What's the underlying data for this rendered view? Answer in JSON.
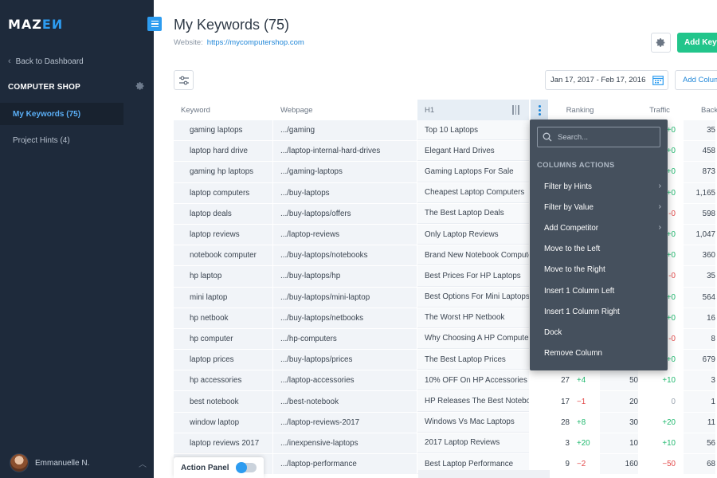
{
  "brand": {
    "logo_main": "MAZ",
    "logo_accent": "EИ"
  },
  "sidebar": {
    "back_label": "Back to Dashboard",
    "project_name": "COMPUTER SHOP",
    "items": [
      {
        "label": "My Keywords (75)"
      },
      {
        "label": "Project Hints (4)"
      }
    ],
    "user_name": "Emmanuelle N."
  },
  "header": {
    "title": "My Keywords (75)",
    "website_label": "Website:",
    "website_url": "https://mycomputershop.com",
    "add_button": "Add Keyw",
    "date_range": "Jan 17, 2017 - Feb 17, 2016",
    "add_column_button": "Add Colum"
  },
  "columns": {
    "keyword": "Keyword",
    "webpage": "Webpage",
    "h1": "H1",
    "ranking": "Ranking",
    "traffic": "Traffic",
    "backlinks": "Back"
  },
  "rows": [
    {
      "keyword": "gaming laptops",
      "webpage": ".../gaming",
      "h1": "Top 10 Laptops",
      "rank": "",
      "rank_delta": "",
      "traffic": "",
      "traffic_delta": "+0",
      "backlinks": "35"
    },
    {
      "keyword": "laptop hard drive",
      "webpage": ".../laptop-internal-hard-drives",
      "h1": "Elegant Hard Drives",
      "rank": "",
      "rank_delta": "",
      "traffic": "",
      "traffic_delta": "+0",
      "backlinks": "458"
    },
    {
      "keyword": "gaming hp laptops",
      "webpage": ".../gaming-laptops",
      "h1": "Gaming Laptops For Sale",
      "rank": "",
      "rank_delta": "",
      "traffic": "",
      "traffic_delta": "+0",
      "backlinks": "873"
    },
    {
      "keyword": "laptop computers",
      "webpage": ".../buy-laptops",
      "h1": "Cheapest Laptop Computers",
      "rank": "",
      "rank_delta": "",
      "traffic": "",
      "traffic_delta": "+0",
      "backlinks": "1,165"
    },
    {
      "keyword": "laptop deals",
      "webpage": ".../buy-laptops/offers",
      "h1": "The Best Laptop Deals",
      "rank": "",
      "rank_delta": "",
      "traffic": "",
      "traffic_delta": "-0",
      "backlinks": "598"
    },
    {
      "keyword": "laptop reviews",
      "webpage": ".../laptop-reviews",
      "h1": "Only Laptop Reviews",
      "rank": "",
      "rank_delta": "",
      "traffic": "",
      "traffic_delta": "+0",
      "backlinks": "1,047"
    },
    {
      "keyword": "notebook computer",
      "webpage": ".../buy-laptops/notebooks",
      "h1": "Brand New Notebook Computers",
      "rank": "",
      "rank_delta": "",
      "traffic": "",
      "traffic_delta": "+0",
      "backlinks": "360"
    },
    {
      "keyword": "hp laptop",
      "webpage": ".../buy-laptops/hp",
      "h1": "Best Prices For HP Laptops",
      "rank": "",
      "rank_delta": "",
      "traffic": "",
      "traffic_delta": "-0",
      "backlinks": "35"
    },
    {
      "keyword": "mini laptop",
      "webpage": ".../buy-laptops/mini-laptop",
      "h1": "Best Options For Mini Laptops",
      "rank": "",
      "rank_delta": "",
      "traffic": "",
      "traffic_delta": "+0",
      "backlinks": "564"
    },
    {
      "keyword": "hp netbook",
      "webpage": ".../buy-laptops/netbooks",
      "h1": "The Worst HP Netbook",
      "rank": "",
      "rank_delta": "",
      "traffic": "",
      "traffic_delta": "+0",
      "backlinks": "16"
    },
    {
      "keyword": "hp computer",
      "webpage": ".../hp-computers",
      "h1": "Why Choosing A HP Computer",
      "rank": "",
      "rank_delta": "",
      "traffic": "",
      "traffic_delta": "-0",
      "backlinks": "8"
    },
    {
      "keyword": "laptop prices",
      "webpage": ".../buy-laptops/prices",
      "h1": "The Best Laptop Prices",
      "rank": "",
      "rank_delta": "",
      "traffic": "",
      "traffic_delta": "+0",
      "backlinks": "679"
    },
    {
      "keyword": "hp accessories",
      "webpage": ".../laptop-accessories",
      "h1": "10% OFF On HP Accessories",
      "rank": "27",
      "rank_delta": "+4",
      "traffic": "50",
      "traffic_delta": "+10",
      "backlinks": "3"
    },
    {
      "keyword": "best notebook",
      "webpage": ".../best-notebook",
      "h1": "HP Releases The Best Notebooks",
      "rank": "17",
      "rank_delta": "−1",
      "traffic": "20",
      "traffic_delta": "0",
      "backlinks": "1"
    },
    {
      "keyword": "window laptop",
      "webpage": ".../laptop-reviews-2017",
      "h1": "Windows Vs Mac Laptops",
      "rank": "28",
      "rank_delta": "+8",
      "traffic": "30",
      "traffic_delta": "+20",
      "backlinks": "11"
    },
    {
      "keyword": "laptop reviews 2017",
      "webpage": ".../inexpensive-laptops",
      "h1": "2017 Laptop Reviews",
      "rank": "3",
      "rank_delta": "+20",
      "traffic": "10",
      "traffic_delta": "+10",
      "backlinks": "56"
    },
    {
      "keyword": "",
      "webpage": ".../laptop-performance",
      "h1": "Best Laptop Performance",
      "rank": "9",
      "rank_delta": "−2",
      "traffic": "160",
      "traffic_delta": "−50",
      "backlinks": "68"
    }
  ],
  "column_menu": {
    "search_placeholder": "Search...",
    "title": "COLUMNS ACTIONS",
    "items": [
      {
        "label": "Filter by Hints",
        "submenu": true
      },
      {
        "label": "Filter by Value",
        "submenu": true
      },
      {
        "label": "Add Competitor",
        "submenu": true
      },
      {
        "label": "Move to the Left",
        "submenu": false
      },
      {
        "label": "Move to the Right",
        "submenu": false
      },
      {
        "label": "Insert 1 Column Left",
        "submenu": false
      },
      {
        "label": "Insert 1 Column Right",
        "submenu": false
      },
      {
        "label": "Dock",
        "submenu": false
      },
      {
        "label": "Remove Column",
        "submenu": false
      }
    ]
  },
  "action_panel": {
    "label": "Action Panel",
    "enabled": true
  },
  "colors": {
    "accent": "#2d9cf0",
    "primary_button": "#22c58b",
    "sidebar_bg": "#1e2a3b",
    "menu_bg": "#45505d",
    "positive": "#21b96f",
    "negative": "#e34b4b"
  }
}
